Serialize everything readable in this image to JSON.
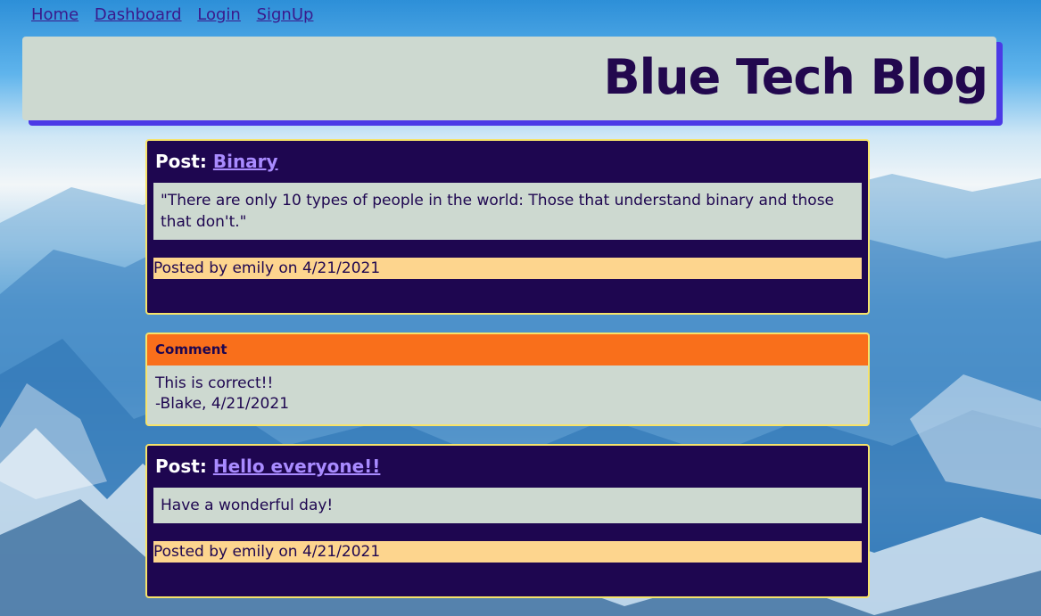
{
  "nav": {
    "home": "Home",
    "dashboard": "Dashboard",
    "login": "Login",
    "signup": "SignUp"
  },
  "header": {
    "title": "Blue Tech Blog"
  },
  "posts": [
    {
      "prefix": "Post:",
      "title": "Binary",
      "body": "\"There are only 10 types of people in the world: Those that understand binary and those that don't.\"",
      "meta": "Posted by emily on 4/21/2021"
    },
    {
      "prefix": "Post:",
      "title": "Hello everyone!!",
      "body": "Have a wonderful day!",
      "meta": "Posted by emily on 4/21/2021"
    }
  ],
  "comment": {
    "heading": "Comment",
    "text": "This is correct!!",
    "byline": "-Blake, 4/21/2021"
  },
  "colors": {
    "post_bg": "#1e0650",
    "card_border": "#f7e36a",
    "header_bg": "#cdd9d0",
    "header_shadow": "#4b3ae6",
    "comment_head": "#f96f1b",
    "meta_bg": "#fdd58e",
    "link": "#a98bff"
  }
}
